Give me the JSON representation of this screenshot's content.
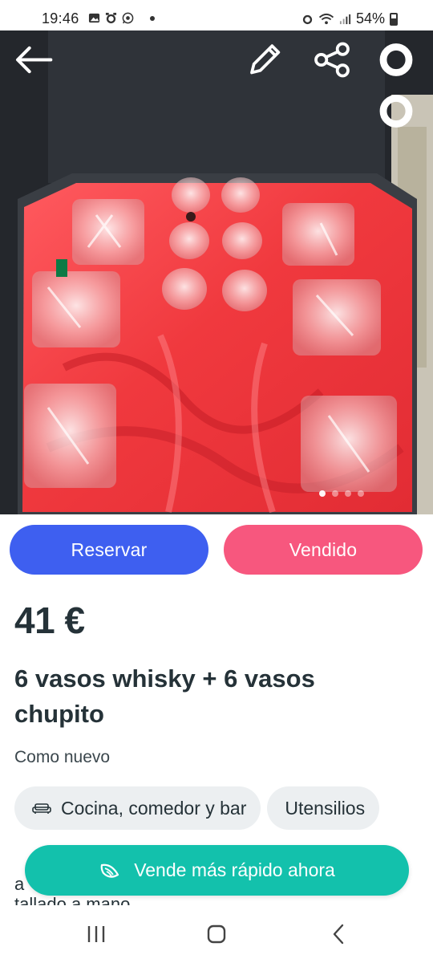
{
  "status_bar": {
    "time": "19:46",
    "battery": "54%",
    "left_icons": [
      "gallery-icon",
      "alarm-icon",
      "whatsapp-icon",
      "dot-icon"
    ],
    "right_icons": [
      "alarm-icon",
      "wifi-icon",
      "signal-icon",
      "battery-icon"
    ]
  },
  "photo": {
    "description_icon_names": [
      "back-arrow-icon",
      "edit-pencil-icon",
      "share-icon",
      "more-vertical-icon"
    ],
    "carousel_total": 4,
    "carousel_active": 1
  },
  "actions": {
    "reserve_label": "Reservar",
    "sold_label": "Vendido",
    "reserve_color": "#3e5ff0",
    "sold_color": "#f7577e"
  },
  "product": {
    "price": "41 €",
    "title": "6 vasos whisky + 6 vasos chupito",
    "condition": "Como nuevo",
    "categories": [
      {
        "label": "Cocina, comedor y bar",
        "icon": "sofa-icon"
      },
      {
        "label": "Utensilios",
        "icon": ""
      }
    ],
    "description_start": "a",
    "description_next": "tallado a mano"
  },
  "promo": {
    "cta_label": "Vende más rápido ahora",
    "icon": "feather-wing-icon",
    "color": "#13c1ac"
  },
  "nav": {
    "icons": [
      "recent-apps-icon",
      "home-icon",
      "back-icon"
    ]
  }
}
